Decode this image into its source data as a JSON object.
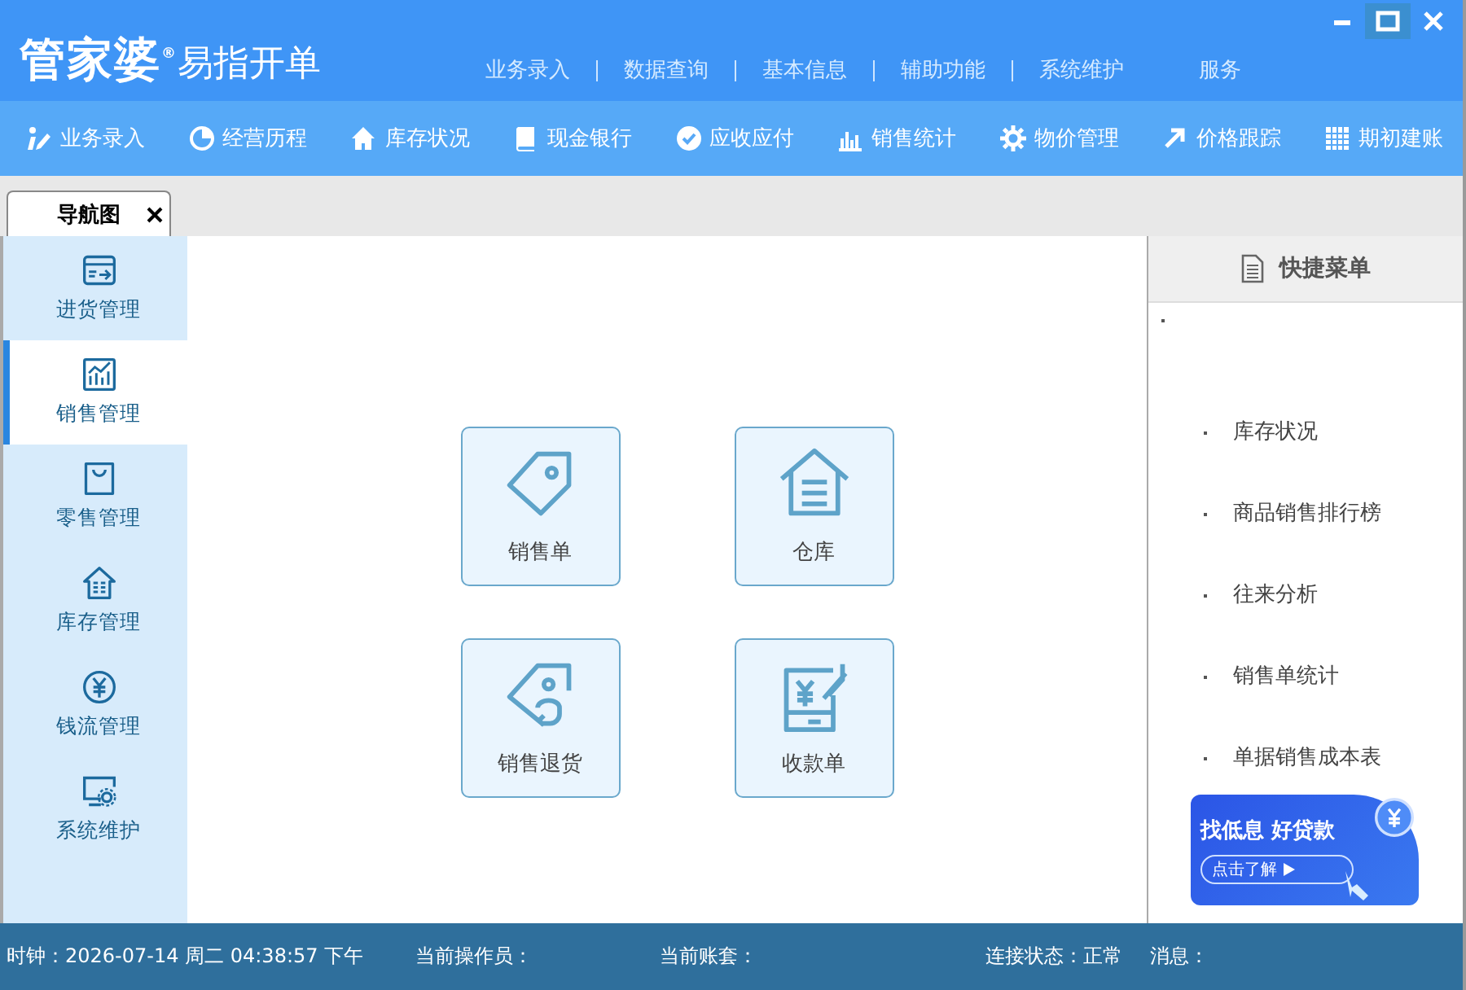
{
  "title_bar": {
    "logo_brand": "管家婆$^{®}$",
    "logo_product": "易指开单",
    "menu": [
      "业务录入",
      "数据查询",
      "基本信息",
      "辅助功能",
      "系统维护",
      "服务"
    ]
  },
  "toolbar": [
    {
      "kind": "pen",
      "label": "业务录入"
    },
    {
      "kind": "pie",
      "label": "经营历程"
    },
    {
      "kind": "home",
      "label": "库存状况"
    },
    {
      "kind": "book",
      "label": "现金银行"
    },
    {
      "kind": "check",
      "label": "应收应付"
    },
    {
      "kind": "bars",
      "label": "销售统计"
    },
    {
      "kind": "gear",
      "label": "物价管理"
    },
    {
      "kind": "arrow",
      "label": "价格跟踪"
    },
    {
      "kind": "grid",
      "label": "期初建账"
    }
  ],
  "tabs": [
    {
      "label": "导航图",
      "selected": true
    }
  ],
  "sidebar": [
    {
      "kind": "inbound",
      "label": "进货管理",
      "selected": false
    },
    {
      "kind": "chart",
      "label": "销售管理",
      "selected": true
    },
    {
      "kind": "bag",
      "label": "零售管理",
      "selected": false
    },
    {
      "kind": "warehouse",
      "label": "库存管理",
      "selected": false
    },
    {
      "kind": "yen",
      "label": "钱流管理",
      "selected": false
    },
    {
      "kind": "monitor",
      "label": "系统维护",
      "selected": false
    }
  ],
  "tiles": [
    {
      "kind": "tag",
      "label": "销售单"
    },
    {
      "kind": "house",
      "label": "仓库"
    },
    {
      "kind": "return",
      "label": "销售退货"
    },
    {
      "kind": "pay",
      "label": "收款单"
    }
  ],
  "quick_menu": {
    "title": "快捷菜单",
    "items": [
      "库存状况",
      "商品销售排行榜",
      "往来分析",
      "销售单统计",
      "单据销售成本表"
    ]
  },
  "banner": {
    "headline": "找低息 好贷款",
    "button": "点击了解"
  },
  "status_bar": [
    "时钟：2026-07-14 周二 04:38:57 下午",
    "当前操作员：",
    "当前账套：",
    "连接状态：正常",
    "消息："
  ]
}
